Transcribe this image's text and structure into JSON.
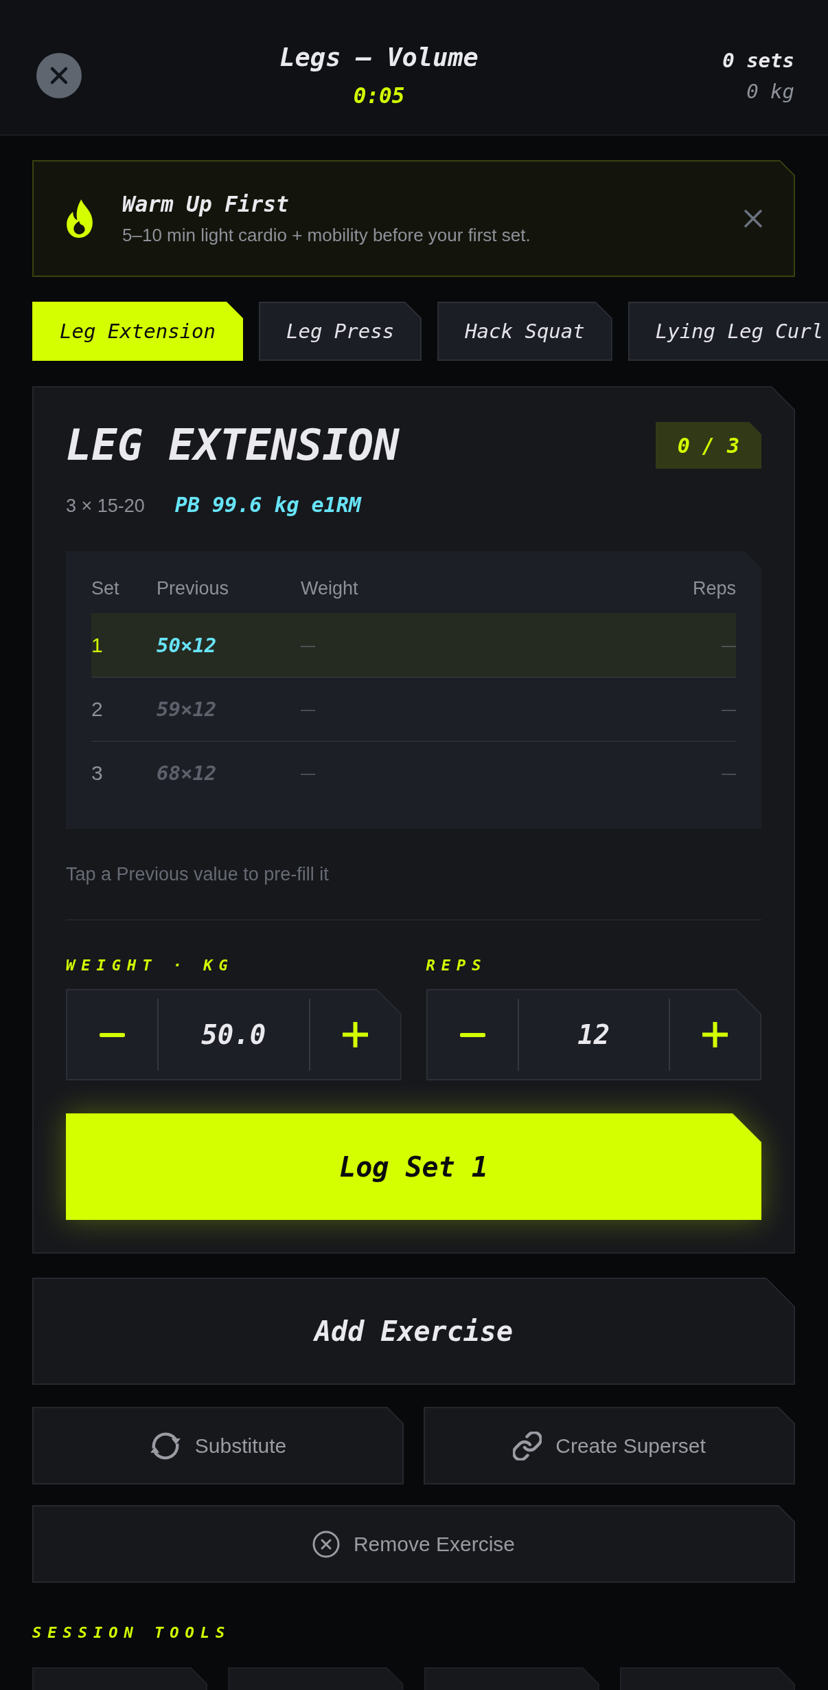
{
  "header": {
    "title": "Legs — Volume",
    "timer": "0:05",
    "sets": "0 sets",
    "volume": "0 kg"
  },
  "banner": {
    "title": "Warm Up First",
    "message": "5–10 min light cardio + mobility before your first set."
  },
  "tabs": [
    {
      "label": "Leg Extension",
      "selected": true
    },
    {
      "label": "Leg Press",
      "selected": false
    },
    {
      "label": "Hack Squat",
      "selected": false
    },
    {
      "label": "Lying Leg Curl",
      "selected": false
    }
  ],
  "exercise": {
    "name": "LEG EXTENSION",
    "progress": "0 / 3",
    "scheme": "3 × 15-20",
    "personal_best": "PB 99.6 kg e1RM",
    "table": {
      "columns": [
        "Set",
        "Previous",
        "Weight",
        "Reps"
      ],
      "rows": [
        {
          "set": "1",
          "previous": "50×12",
          "weight": "—",
          "reps": "—",
          "selected": true
        },
        {
          "set": "2",
          "previous": "59×12",
          "weight": "—",
          "reps": "—",
          "selected": false
        },
        {
          "set": "3",
          "previous": "68×12",
          "weight": "—",
          "reps": "—",
          "selected": false
        }
      ]
    },
    "hint": "Tap a Previous value to pre-fill it",
    "inputs": [
      {
        "label": "WEIGHT · KG",
        "value": "50.0"
      },
      {
        "label": "REPS",
        "value": "12"
      }
    ],
    "log_button": "Log Set 1"
  },
  "actions": {
    "add_exercise": "Add Exercise",
    "substitute": "Substitute",
    "create_superset": "Create Superset",
    "remove_exercise": "Remove Exercise"
  },
  "session_tools": {
    "label": "SESSION TOOLS"
  }
}
